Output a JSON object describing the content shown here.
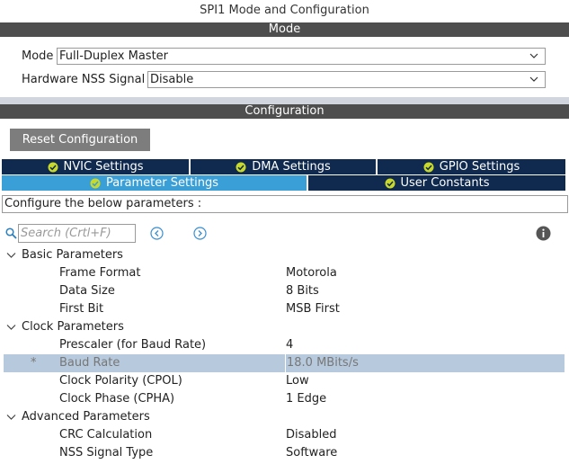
{
  "window": {
    "title": "SPI1 Mode and Configuration"
  },
  "mode_section": {
    "header": "Mode",
    "mode": {
      "label": "Mode",
      "value": "Full-Duplex Master"
    },
    "nss": {
      "label": "Hardware NSS Signal",
      "value": "Disable"
    }
  },
  "config_section": {
    "header": "Configuration",
    "reset_label": "Reset Configuration",
    "tabs_row1": [
      {
        "label": "NVIC Settings"
      },
      {
        "label": "DMA Settings"
      },
      {
        "label": "GPIO Settings"
      }
    ],
    "tabs_row2": [
      {
        "label": "Parameter Settings",
        "active": true
      },
      {
        "label": "User Constants"
      }
    ],
    "configure_text": "Configure the below parameters :",
    "search": {
      "placeholder": "Search (Crtl+F)"
    },
    "groups": [
      {
        "label": "Basic Parameters",
        "params": [
          {
            "name": "Frame Format",
            "value": "Motorola"
          },
          {
            "name": "Data Size",
            "value": "8 Bits"
          },
          {
            "name": "First Bit",
            "value": "MSB First"
          }
        ]
      },
      {
        "label": "Clock Parameters",
        "params": [
          {
            "name": "Prescaler (for Baud Rate)",
            "value": "4"
          },
          {
            "name": "Baud Rate",
            "value": "18.0 MBits/s",
            "marker": "*",
            "selected": true
          },
          {
            "name": "Clock Polarity (CPOL)",
            "value": "Low"
          },
          {
            "name": "Clock Phase (CPHA)",
            "value": "1 Edge"
          }
        ]
      },
      {
        "label": "Advanced Parameters",
        "params": [
          {
            "name": "CRC Calculation",
            "value": "Disabled"
          },
          {
            "name": "NSS Signal Type",
            "value": "Software"
          }
        ]
      }
    ]
  },
  "colors": {
    "section_bar": "#4e4e4e",
    "tab_inactive": "#0f2a4e",
    "tab_active": "#3a9fd6",
    "check_icon": "#c8d92a",
    "selected_row": "#b7c9dc"
  }
}
